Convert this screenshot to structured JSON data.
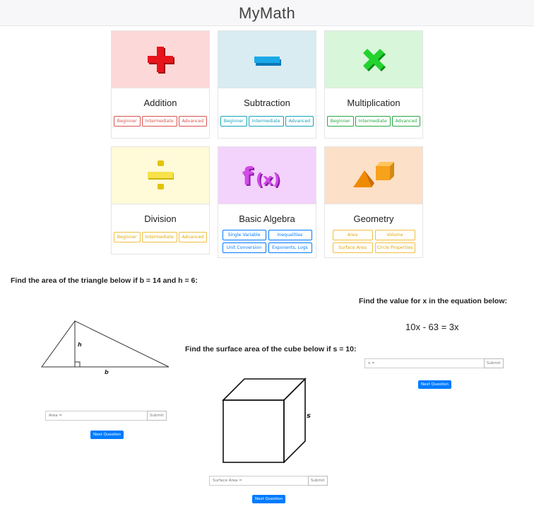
{
  "app": {
    "title": "MyMath"
  },
  "categories": [
    {
      "name": "Addition",
      "levels": [
        "Beginner",
        "Intermediate",
        "Advanced"
      ]
    },
    {
      "name": "Subtraction",
      "levels": [
        "Beginner",
        "Intermediate",
        "Advanced"
      ]
    },
    {
      "name": "Multiplication",
      "levels": [
        "Beginner",
        "Intermediate",
        "Advanced"
      ]
    },
    {
      "name": "Division",
      "levels": [
        "Beginner",
        "Intermediate",
        "Advanced"
      ]
    },
    {
      "name": "Basic Algebra",
      "topics": [
        "Single Variable",
        "Inequalities",
        "Unit Conversion",
        "Exponents, Logs"
      ]
    },
    {
      "name": "Geometry",
      "topics": [
        "Area",
        "Volume",
        "Surface Area",
        "Circle Properties"
      ]
    }
  ],
  "icons": {
    "addition": "plus-icon",
    "subtraction": "minus-icon",
    "multiplication": "times-icon",
    "division": "divide-icon",
    "algebra": "function-icon",
    "geometry": "shapes-icon"
  },
  "colors": {
    "addition_bg": "#fdd8d8",
    "subtraction_bg": "#d8ecf1",
    "multiplication_bg": "#d8f6d9",
    "division_bg": "#fffad8",
    "algebra_bg": "#f3d3fb",
    "geometry_bg": "#fde0c8",
    "primary": "#007bff"
  },
  "questions": {
    "triangle": {
      "prompt": "Find the area of the triangle below if b = 14 and h = 6:",
      "label_h": "h",
      "label_b": "b",
      "placeholder": "Area =",
      "submit": "Submit",
      "next": "Next Question"
    },
    "cube": {
      "prompt": "Find the surface area of the cube below if s = 10:",
      "label_s": "s",
      "placeholder": "Surface Area =",
      "submit": "Submit",
      "next": "Next Question"
    },
    "equation": {
      "prompt": "Find the value for x in the equation below:",
      "equation": "10x - 63 = 3x",
      "placeholder": "x =",
      "submit": "Submit",
      "next": "Next Question"
    }
  }
}
